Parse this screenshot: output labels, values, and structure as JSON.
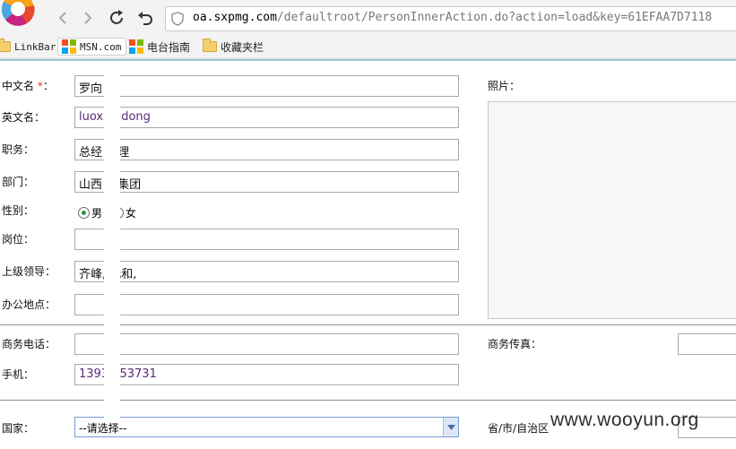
{
  "browser": {
    "url_host": "oa.sxpmg.com",
    "url_path": "/defaultroot/PersonInnerAction.do?action=load&key=61EFAA7D7118",
    "bookmarks": [
      {
        "label": "LinkBar",
        "icon": "folder-icon"
      },
      {
        "label": "MSN.com",
        "icon": "windows-icon"
      },
      {
        "label": "电台指南",
        "icon": "windows-icon"
      },
      {
        "label": "收藏夹栏",
        "icon": "folder-icon"
      }
    ]
  },
  "form": {
    "chinese_name": {
      "label": "中文名",
      "required_mark": "*",
      "colon": "：",
      "value": "罗向"
    },
    "english_name": {
      "label": "英文名：",
      "value": "luoxingdong"
    },
    "job_title": {
      "label": "职务：",
      "value": "总经    助理"
    },
    "department": {
      "label": "部门：",
      "value": "山西    版集团"
    },
    "gender": {
      "label": "性别：",
      "options": [
        "男",
        "女"
      ],
      "selected": "男"
    },
    "post": {
      "label": "岗位：",
      "value": ""
    },
    "superior": {
      "label": "上级领导：",
      "value": "齐峰,    元和,"
    },
    "office_location": {
      "label": "办公地点：",
      "value": ""
    },
    "business_phone": {
      "label": "商务电话：",
      "value": ""
    },
    "mobile": {
      "label": "手机：",
      "value": "13934    53731"
    },
    "country": {
      "label": "国家：",
      "selected": "--请选择--"
    },
    "photo": {
      "label": "照片："
    },
    "business_fax": {
      "label": "商务传真："
    },
    "province": {
      "label": "省/市/自治区"
    }
  },
  "watermark": "www.wooyun.org",
  "colors": {
    "required": "#e03030",
    "radio_selected": "#2a9a3a",
    "accent_line": "#9cc7d6"
  }
}
